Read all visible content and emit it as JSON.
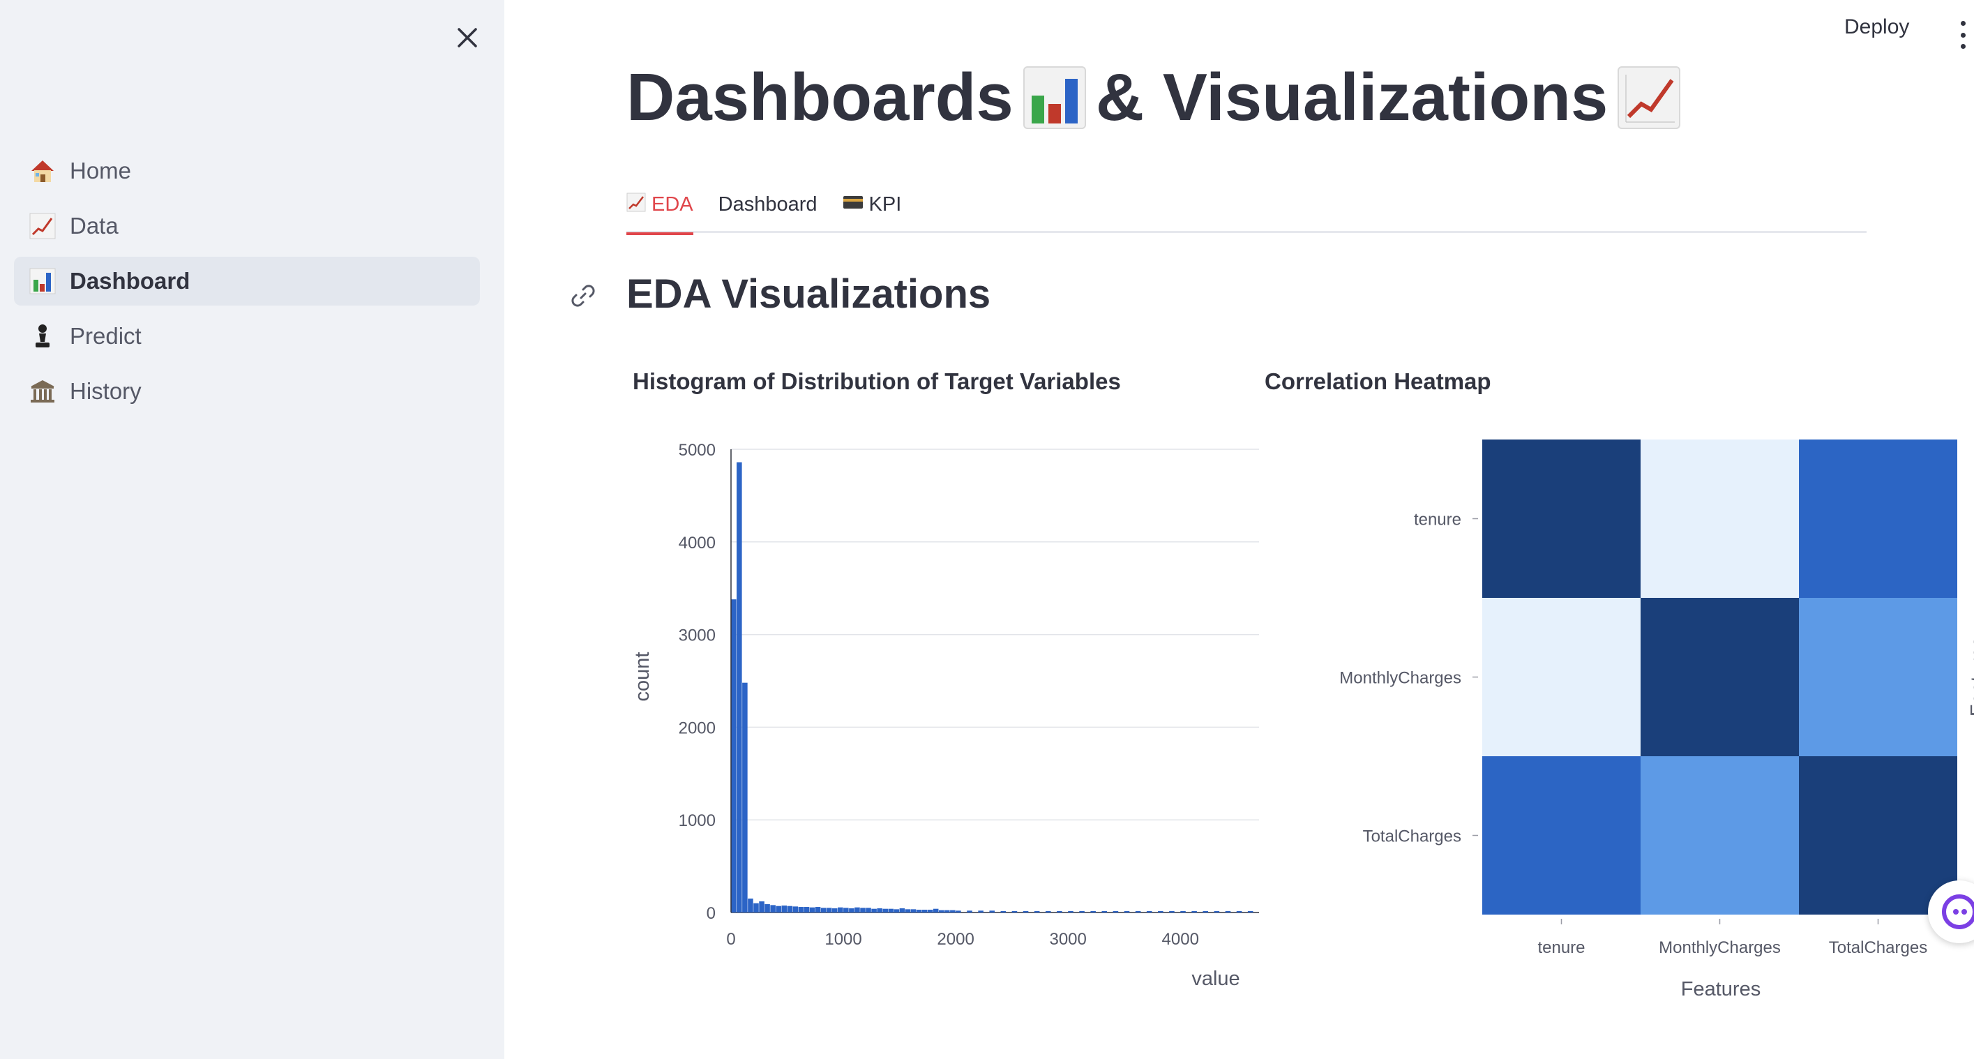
{
  "sidebar": {
    "items": [
      {
        "label": "Home",
        "icon": "house-icon",
        "active": false
      },
      {
        "label": "Data",
        "icon": "chart-increasing-icon",
        "active": false
      },
      {
        "label": "Dashboard",
        "icon": "bar-chart-icon",
        "active": true
      },
      {
        "label": "Predict",
        "icon": "chess-pawn-icon",
        "active": false
      },
      {
        "label": "History",
        "icon": "classical-building-icon",
        "active": false
      }
    ]
  },
  "header": {
    "deploy_label": "Deploy"
  },
  "page": {
    "title_part1": "Dashboards",
    "title_part2": "& Visualizations",
    "title_icons": [
      "bar-chart-icon",
      "chart-increasing-icon"
    ]
  },
  "tabs": [
    {
      "label": "EDA",
      "icon": "chart-increasing-icon",
      "active": true
    },
    {
      "label": "Dashboard",
      "icon": "",
      "active": false
    },
    {
      "label": "KPI",
      "icon": "credit-card-icon",
      "active": false
    }
  ],
  "section": {
    "title": "EDA Visualizations"
  },
  "colors": {
    "accent": "#e0464b",
    "bar": "#2c64c6",
    "sidebar_bg": "#f0f2f6"
  },
  "chart_data": [
    {
      "type": "bar",
      "title": "Histogram of Distribution of Target Variables",
      "xlabel": "value",
      "ylabel": "count",
      "ylim": [
        0,
        5000
      ],
      "xlim": [
        0,
        4700
      ],
      "x_ticks": [
        "0",
        "1000",
        "2000",
        "3000",
        "4000"
      ],
      "y_ticks": [
        "0",
        "1000",
        "2000",
        "3000",
        "4000",
        "5000"
      ],
      "bin_width": 50,
      "x": [
        0,
        50,
        100,
        150,
        200,
        250,
        300,
        350,
        400,
        450,
        500,
        550,
        600,
        650,
        700,
        750,
        800,
        850,
        900,
        950,
        1000,
        1050,
        1100,
        1150,
        1200,
        1250,
        1300,
        1350,
        1400,
        1450,
        1500,
        1550,
        1600,
        1650,
        1700,
        1750,
        1800,
        1850,
        1900,
        1950,
        2000,
        2100,
        2200,
        2300,
        2400,
        2500,
        2600,
        2700,
        2800,
        2900,
        3000,
        3100,
        3200,
        3300,
        3400,
        3500,
        3600,
        3700,
        3800,
        3900,
        4000,
        4100,
        4200,
        4300,
        4400,
        4500,
        4600
      ],
      "values": [
        3380,
        4860,
        2480,
        150,
        100,
        120,
        90,
        80,
        70,
        75,
        70,
        65,
        60,
        60,
        55,
        60,
        50,
        50,
        45,
        55,
        50,
        45,
        55,
        50,
        50,
        40,
        45,
        40,
        40,
        35,
        45,
        35,
        35,
        30,
        30,
        30,
        40,
        25,
        25,
        25,
        20,
        20,
        20,
        20,
        15,
        15,
        15,
        15,
        15,
        15,
        15,
        15,
        15,
        15,
        15,
        15,
        15,
        15,
        15,
        15,
        15,
        15,
        15,
        15,
        15,
        15,
        15
      ]
    },
    {
      "type": "heatmap",
      "title": "Correlation Heatmap",
      "xlabel": "Features",
      "ylabel": "Features",
      "x": [
        "tenure",
        "MonthlyCharges",
        "TotalCharges"
      ],
      "y": [
        "tenure",
        "MonthlyCharges",
        "TotalCharges"
      ],
      "values": [
        [
          1.0,
          0.25,
          0.83
        ],
        [
          0.25,
          1.0,
          0.65
        ],
        [
          0.83,
          0.65,
          1.0
        ]
      ],
      "colors": [
        [
          "#1a3f7a",
          "#e6f1fc",
          "#2c65c4"
        ],
        [
          "#e6f1fc",
          "#1a3f7a",
          "#5d9ae6"
        ],
        [
          "#2c65c4",
          "#5d9ae6",
          "#1a3f7a"
        ]
      ]
    }
  ]
}
